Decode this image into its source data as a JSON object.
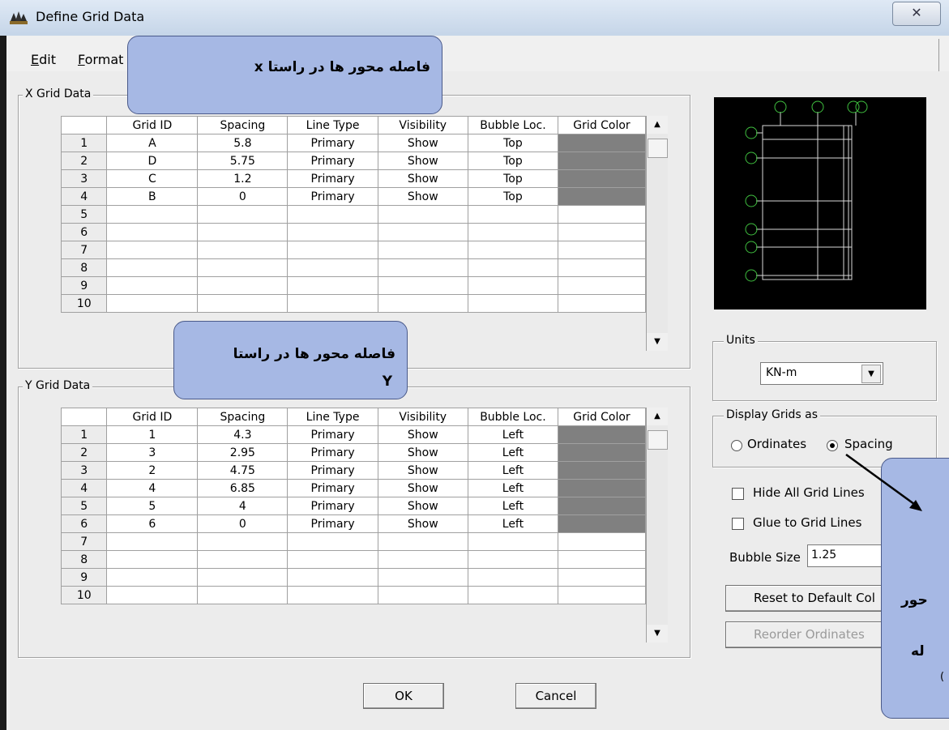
{
  "window": {
    "title": "Define Grid Data",
    "close_glyph": "✕"
  },
  "menu": {
    "edit": "Edit",
    "format": "Format"
  },
  "x_grid": {
    "label": "X Grid Data",
    "headers": [
      "",
      "Grid ID",
      "Spacing",
      "Line Type",
      "Visibility",
      "Bubble Loc.",
      "Grid Color"
    ],
    "rows": [
      [
        "1",
        "A",
        "5.8",
        "Primary",
        "Show",
        "Top"
      ],
      [
        "2",
        "D",
        "5.75",
        "Primary",
        "Show",
        "Top"
      ],
      [
        "3",
        "C",
        "1.2",
        "Primary",
        "Show",
        "Top"
      ],
      [
        "4",
        "B",
        "0",
        "Primary",
        "Show",
        "Top"
      ],
      [
        "5",
        "",
        "",
        "",
        "",
        "",
        ""
      ],
      [
        "6",
        "",
        "",
        "",
        "",
        "",
        ""
      ],
      [
        "7",
        "",
        "",
        "",
        "",
        "",
        ""
      ],
      [
        "8",
        "",
        "",
        "",
        "",
        "",
        ""
      ],
      [
        "9",
        "",
        "",
        "",
        "",
        "",
        ""
      ],
      [
        "10",
        "",
        "",
        "",
        "",
        "",
        ""
      ]
    ]
  },
  "y_grid": {
    "label": "Y Grid Data",
    "headers": [
      "",
      "Grid ID",
      "Spacing",
      "Line Type",
      "Visibility",
      "Bubble Loc.",
      "Grid Color"
    ],
    "rows": [
      [
        "1",
        "1",
        "4.3",
        "Primary",
        "Show",
        "Left"
      ],
      [
        "2",
        "3",
        "2.95",
        "Primary",
        "Show",
        "Left"
      ],
      [
        "3",
        "2",
        "4.75",
        "Primary",
        "Show",
        "Left"
      ],
      [
        "4",
        "4",
        "6.85",
        "Primary",
        "Show",
        "Left"
      ],
      [
        "5",
        "5",
        "4",
        "Primary",
        "Show",
        "Left"
      ],
      [
        "6",
        "6",
        "0",
        "Primary",
        "Show",
        "Left"
      ],
      [
        "7",
        "",
        "",
        "",
        "",
        "",
        ""
      ],
      [
        "8",
        "",
        "",
        "",
        "",
        "",
        ""
      ],
      [
        "9",
        "",
        "",
        "",
        "",
        "",
        ""
      ],
      [
        "10",
        "",
        "",
        "",
        "",
        "",
        ""
      ]
    ]
  },
  "grid_color": "#808080",
  "units": {
    "label": "Units",
    "value": "KN-m"
  },
  "display": {
    "label": "Display Grids as",
    "ordinates": "Ordinates",
    "spacing": "Spacing",
    "selected": "Spacing"
  },
  "options": {
    "hide_all": "Hide All Grid Lines",
    "glue": "Glue to Grid Lines"
  },
  "bubble": {
    "label": "Bubble Size",
    "value": "1.25"
  },
  "buttons": {
    "reset": "Reset to Default Col",
    "reorder": "Reorder Ordinates",
    "ok": "OK",
    "cancel": "Cancel"
  },
  "callouts": {
    "x": "فاصله محور ها در راستا x",
    "y_line1": "فاصله محور ها در راستا",
    "y_line2": "Y",
    "right_line1": "حور",
    "right_line2": "له",
    "right_line3": ")"
  }
}
